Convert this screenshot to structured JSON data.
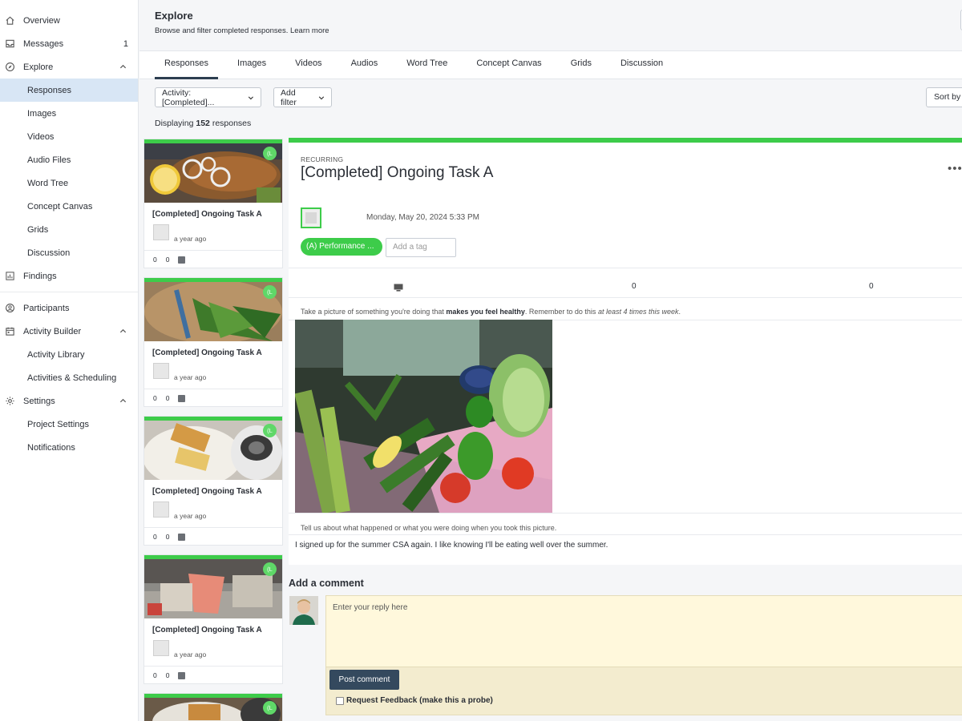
{
  "sidebar": {
    "items": [
      {
        "label": "Overview"
      },
      {
        "label": "Messages",
        "count": "1"
      },
      {
        "label": "Explore"
      },
      {
        "label": "Responses"
      },
      {
        "label": "Images"
      },
      {
        "label": "Videos"
      },
      {
        "label": "Audio Files"
      },
      {
        "label": "Word Tree"
      },
      {
        "label": "Concept Canvas"
      },
      {
        "label": "Grids"
      },
      {
        "label": "Discussion"
      },
      {
        "label": "Findings"
      },
      {
        "label": "Participants"
      },
      {
        "label": "Activity Builder"
      },
      {
        "label": "Activity Library"
      },
      {
        "label": "Activities & Scheduling"
      },
      {
        "label": "Settings"
      },
      {
        "label": "Project Settings"
      },
      {
        "label": "Notifications"
      }
    ]
  },
  "header": {
    "title": "Explore",
    "subtitle": "Browse and filter completed responses.",
    "learn_more": "Learn more"
  },
  "tabs": [
    "Responses",
    "Images",
    "Videos",
    "Audios",
    "Word Tree",
    "Concept Canvas",
    "Grids",
    "Discussion"
  ],
  "filters": {
    "activity": "Activity: [Completed]...",
    "add_filter": "Add filter",
    "sort": "Sort by",
    "displaying_prefix": "Displaying",
    "count": "152",
    "displaying_suffix": "responses"
  },
  "cards": [
    {
      "title": "[Completed] Ongoing Task A",
      "badge": "(L",
      "ago": "a year ago",
      "c1": "0",
      "c2": "0"
    },
    {
      "title": "[Completed] Ongoing Task A",
      "badge": "(L",
      "ago": "a year ago",
      "c1": "0",
      "c2": "0"
    },
    {
      "title": "[Completed] Ongoing Task A",
      "badge": "(L",
      "ago": "a year ago",
      "c1": "0",
      "c2": "0"
    },
    {
      "title": "[Completed] Ongoing Task A",
      "badge": "(L",
      "ago": "a year ago",
      "c1": "0",
      "c2": "0"
    },
    {
      "badge": "(L"
    }
  ],
  "detail": {
    "type": "RECURRING",
    "title": "[Completed] Ongoing Task A",
    "date": "Monday, May 20, 2024 5:33 PM",
    "tag": "(A) Performance ...",
    "tag_placeholder": "Add a tag",
    "metric_a": "0",
    "metric_b": "0",
    "prompt1_a": "Take a picture of something you're doing that",
    "prompt1_b": "makes you feel healthy",
    "prompt1_c": ". Remember to do this",
    "prompt1_d": "at least 4 times this week",
    "prompt1_e": ".",
    "prompt2": "Tell us about what happened or what you were doing when you took this picture.",
    "answer": "I signed up for the summer CSA again. I like knowing I'll be eating well over the summer."
  },
  "comment": {
    "heading": "Add a comment",
    "placeholder": "Enter your reply here",
    "post": "Post comment",
    "probe": "Request Feedback (make this a probe)"
  },
  "colors": {
    "accent": "#3dcc4a",
    "nav_active": "#d8e6f5",
    "primary_btn": "#34495e",
    "comment_bg": "#fff8dc"
  }
}
